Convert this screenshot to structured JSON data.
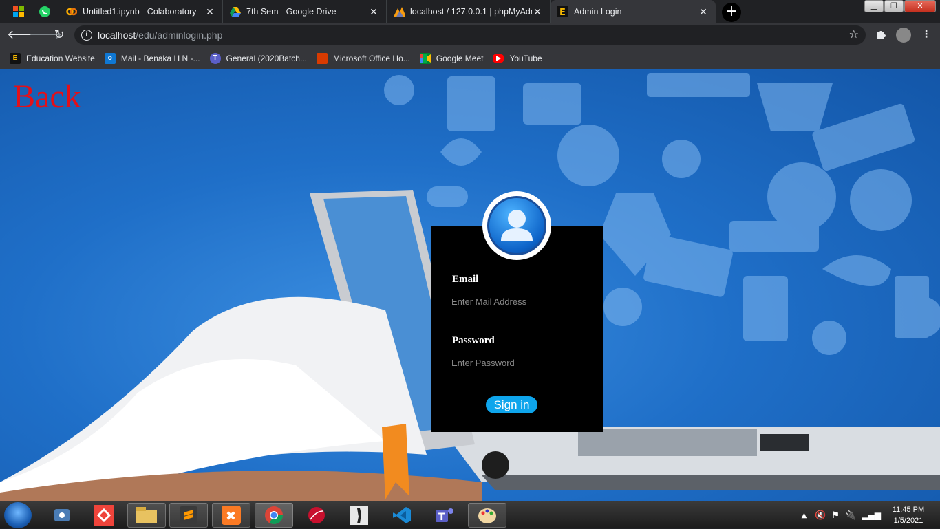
{
  "tabs": [
    {
      "title": "Untitled1.ipynb - Colaboratory",
      "icon": "colab-icon"
    },
    {
      "title": "7th Sem - Google Drive",
      "icon": "drive-icon"
    },
    {
      "title": "localhost / 127.0.0.1 | phpMyAdm",
      "icon": "phpmyadmin-icon"
    },
    {
      "title": "Admin Login",
      "icon": "site-e-icon",
      "active": true
    }
  ],
  "address": {
    "host": "localhost",
    "path": "/edu/adminlogin.php"
  },
  "bookmarks": [
    {
      "label": "Education Website",
      "icon": "site-e-icon"
    },
    {
      "label": "Mail - Benaka H N -...",
      "icon": "outlook-icon"
    },
    {
      "label": "General (2020Batch...",
      "icon": "teams-icon"
    },
    {
      "label": "Microsoft Office Ho...",
      "icon": "office-icon"
    },
    {
      "label": "Google Meet",
      "icon": "meet-icon"
    },
    {
      "label": "YouTube",
      "icon": "youtube-icon"
    }
  ],
  "page": {
    "back_label": "Back",
    "email_label": "Email",
    "email_placeholder": "Enter Mail Address",
    "password_label": "Password",
    "password_placeholder": "Enter Password",
    "signin_label": "Sign in"
  },
  "taskbar": {
    "time": "11:45 PM",
    "date": "1/5/2021"
  },
  "colors": {
    "back_link": "#e3101a",
    "signin_button": "#0ea5ec",
    "card": "#000000",
    "background": "#1f6fc8"
  }
}
